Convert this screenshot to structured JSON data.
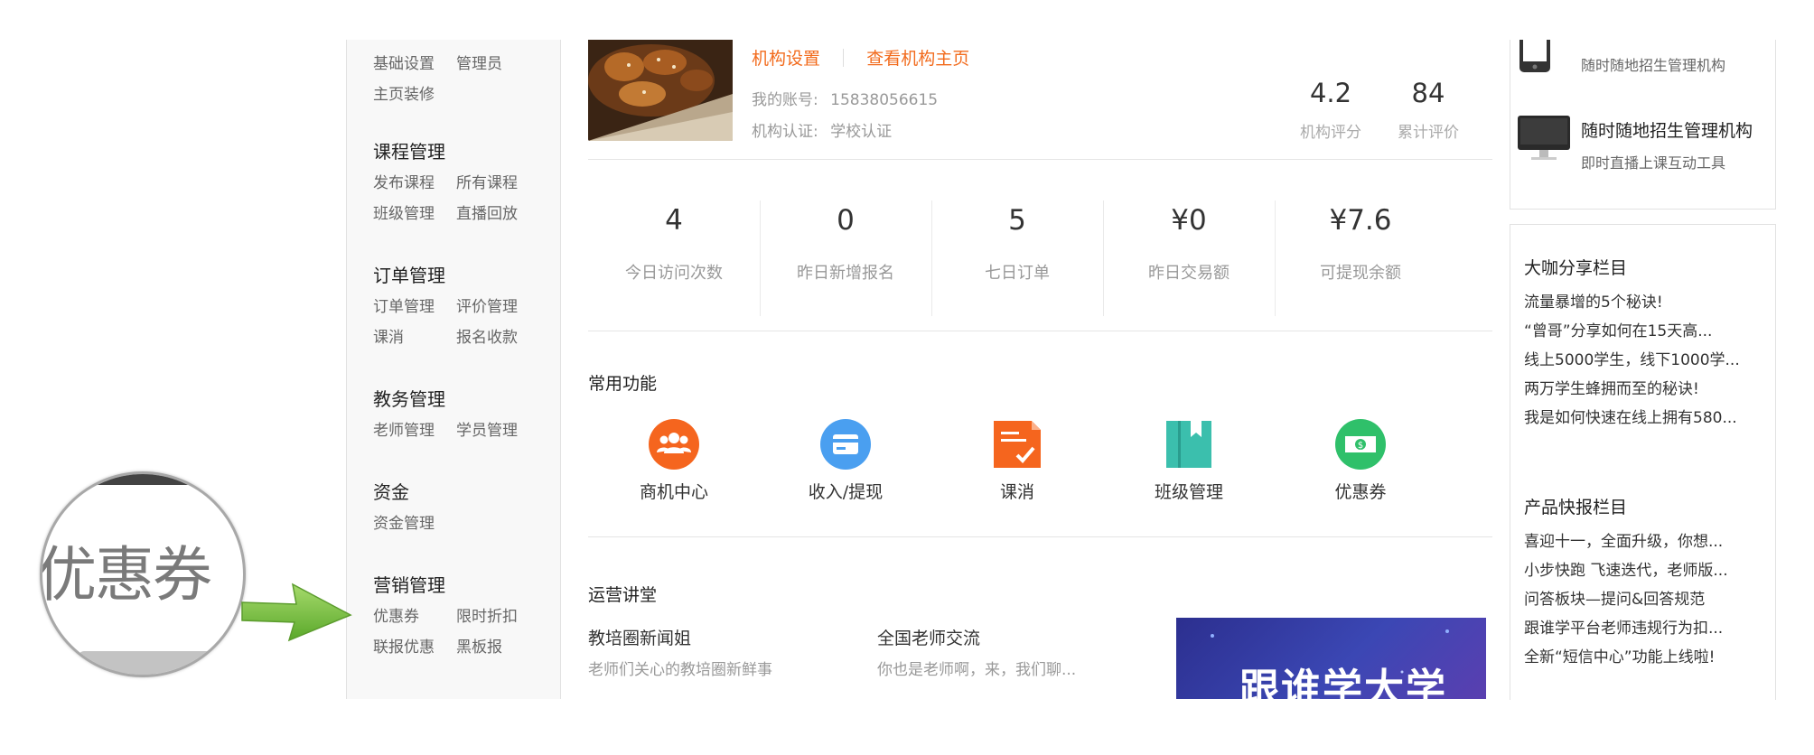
{
  "sidebar": {
    "top_items": [
      [
        "基础设置",
        "管理员"
      ],
      [
        "主页装修"
      ]
    ],
    "groups": [
      {
        "title": "课程管理",
        "rows": [
          [
            "发布课程",
            "所有课程"
          ],
          [
            "班级管理",
            "直播回放"
          ]
        ]
      },
      {
        "title": "订单管理",
        "rows": [
          [
            "订单管理",
            "评价管理"
          ],
          [
            "课消",
            "报名收款"
          ]
        ]
      },
      {
        "title": "教务管理",
        "rows": [
          [
            "老师管理",
            "学员管理"
          ]
        ]
      },
      {
        "title": "资金",
        "rows": [
          [
            "资金管理"
          ]
        ]
      },
      {
        "title": "营销管理",
        "rows": [
          [
            "优惠券",
            "限时折扣"
          ],
          [
            "联报优惠",
            "黑板报"
          ]
        ]
      }
    ]
  },
  "org": {
    "settings_link": "机构设置",
    "home_link": "查看机构主页",
    "account_label": "我的账号:",
    "account_value": "15838056615",
    "cert_label": "机构认证:",
    "cert_value": "学校认证",
    "rating_value": "4.2",
    "rating_label": "机构评分",
    "reviews_value": "84",
    "reviews_label": "累计评价"
  },
  "stats": [
    {
      "value": "4",
      "label": "今日访问次数"
    },
    {
      "value": "0",
      "label": "昨日新增报名"
    },
    {
      "value": "5",
      "label": "七日订单"
    },
    {
      "value": "¥0",
      "label": "昨日交易额"
    },
    {
      "value": "¥7.6",
      "label": "可提现余额"
    }
  ],
  "features": {
    "title": "常用功能",
    "items": [
      {
        "label": "商机中心",
        "icon": "group-icon",
        "color": "#f5651e"
      },
      {
        "label": "收入/提现",
        "icon": "card-icon",
        "color": "#4a9ff0"
      },
      {
        "label": "课消",
        "icon": "document-check-icon",
        "color": "#f5651e"
      },
      {
        "label": "班级管理",
        "icon": "book-icon",
        "color": "#3bbfad"
      },
      {
        "label": "优惠券",
        "icon": "money-icon",
        "color": "#2fc06a"
      }
    ]
  },
  "lecture": {
    "title": "运营讲堂",
    "items": [
      {
        "title": "教培圈新闻姐",
        "desc": "老师们关心的教培圈新鲜事"
      },
      {
        "title": "全国老师交流",
        "desc": "你也是老师啊，来，我们聊..."
      }
    ],
    "banner_text": "跟谁学大学"
  },
  "right": {
    "app_promos": [
      {
        "title": "",
        "desc": "随时随地招生管理机构",
        "icon": "phone-icon"
      },
      {
        "title": "随时随地招生管理机构",
        "desc": "即时直播上课互动工具",
        "icon": "monitor-icon"
      }
    ],
    "share": {
      "title": "大咖分享栏目",
      "items": [
        "流量暴增的5个秘诀!",
        "“曾哥”分享如何在15天高...",
        "线上5000学生，线下1000学...",
        "两万学生蜂拥而至的秘诀!",
        "我是如何快速在线上拥有580..."
      ]
    },
    "news": {
      "title": "产品快报栏目",
      "items": [
        "喜迎十一，全面升级，你想...",
        "小步快跑 飞速迭代，老师版...",
        "问答板块—提问&回答规范",
        "跟谁学平台老师违规行为扣...",
        "全新“短信中心”功能上线啦!"
      ]
    }
  },
  "callout": {
    "zoom_text": "优惠券",
    "colors": {
      "arrow": "#7cc241",
      "ring": "#a8a8a8"
    }
  }
}
